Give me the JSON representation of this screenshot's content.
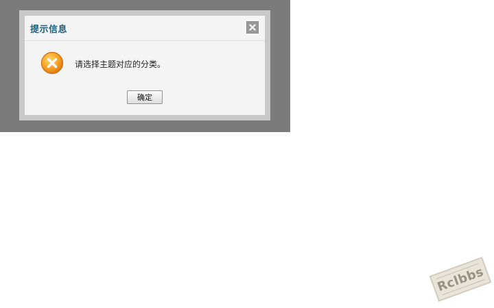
{
  "dialog": {
    "title": "提示信息",
    "message": "请选择主题对应的分类。",
    "ok_label": "确定",
    "icon": "error-x-icon",
    "close_icon": "close-icon"
  },
  "watermark": {
    "text": "Rclbbs"
  },
  "colors": {
    "overlay": "#7b7b7b",
    "dialog_bg": "#f4f4f4",
    "title": "#1f5f7a",
    "icon_orange": "#f29a1e"
  }
}
